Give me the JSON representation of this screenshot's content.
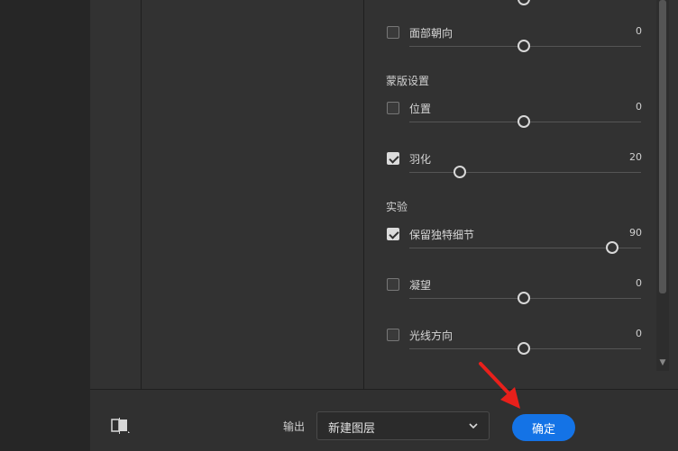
{
  "settings": {
    "face_direction": {
      "label": "面部朝向",
      "value": "0",
      "checked": false
    },
    "mask_section_title": "蒙版设置",
    "position": {
      "label": "位置",
      "value": "0",
      "checked": false
    },
    "feather": {
      "label": "羽化",
      "value": "20",
      "checked": true
    },
    "experiment_section_title": "实验",
    "preserve_detail": {
      "label": "保留独特细节",
      "value": "90",
      "checked": true
    },
    "gaze": {
      "label": "凝望",
      "value": "0",
      "checked": false
    },
    "light_direction": {
      "label": "光线方向",
      "value": "0",
      "checked": false
    }
  },
  "footer": {
    "output_label": "输出",
    "output_select_value": "新建图层",
    "ok_label": "确定"
  },
  "icons": {
    "compare": "before-after-compare-icon",
    "select": "chevron-down-icon",
    "annotation": "red-arrow-icon"
  },
  "colors": {
    "accent": "#1473e6",
    "annotation": "#e8201b"
  }
}
